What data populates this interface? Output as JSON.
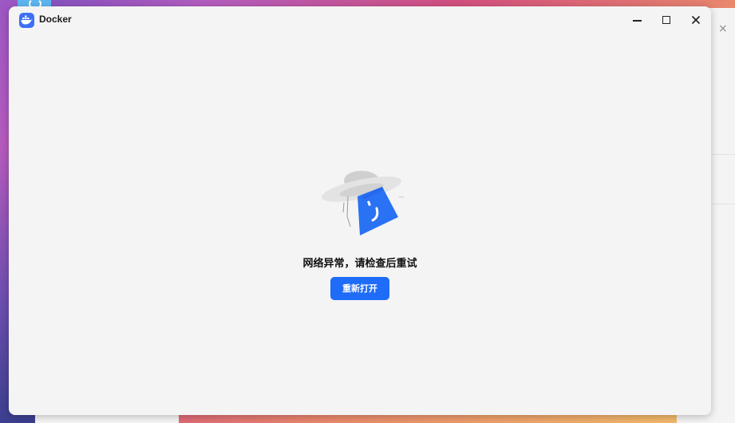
{
  "window": {
    "title": "Docker",
    "app_icon": "docker-whale-icon",
    "controls": {
      "minimize": "minimize-icon",
      "maximize": "maximize-icon",
      "close": "close-icon"
    }
  },
  "error": {
    "message": "网络异常，请检查后重试",
    "illustration": "ufo-ghost-illustration"
  },
  "actions": {
    "reopen_label": "重新打开"
  },
  "background_window": {
    "close_glyph": "×"
  },
  "colors": {
    "accent": "#1e6cf7",
    "window_bg": "#f4f4f4",
    "logo_bg": "#3e6ff4"
  }
}
